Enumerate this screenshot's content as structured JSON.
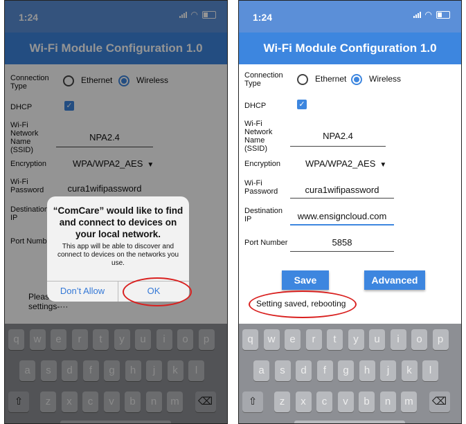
{
  "status": {
    "time": "1:24"
  },
  "app_title": "Wi-Fi Module Configuration 1.0",
  "labels": {
    "connection_type": "Connection Type",
    "dhcp": "DHCP",
    "ssid": "Wi-Fi Network Name (SSID)",
    "encryption": "Encryption",
    "password": "Wi-Fi Password",
    "destination_ip": "Destination IP",
    "port_number": "Port Number",
    "port_number_truncated": "Port Numb"
  },
  "options": {
    "ethernet": "Ethernet",
    "wireless": "Wireless"
  },
  "values": {
    "ssid": "NPA2.4",
    "encryption": "WPA/WPA2_AES",
    "password": "cura1wifipassword",
    "destination_ip": "www.ensigncloud.com",
    "port_number": "5858"
  },
  "dialog": {
    "title": "“ComCare” would like to find and connect to devices on your local network.",
    "body": "This app will be able to discover and connect to devices on the networks you use.",
    "dont_allow": "Don’t Allow",
    "ok": "OK"
  },
  "left_bg_text": {
    "line1": "Pleas",
    "line2": "settings-···"
  },
  "buttons": {
    "save": "Save",
    "advanced": "Advanced"
  },
  "status_message": "Setting saved, rebooting",
  "keyboard": {
    "row1": [
      "q",
      "w",
      "e",
      "r",
      "t",
      "y",
      "u",
      "i",
      "o",
      "p"
    ],
    "row2": [
      "a",
      "s",
      "d",
      "f",
      "g",
      "h",
      "j",
      "k",
      "l"
    ],
    "row3": [
      "z",
      "x",
      "c",
      "v",
      "b",
      "n",
      "m"
    ],
    "shift": "⇧",
    "delete": "⌫"
  },
  "colors": {
    "accent": "#3d86df",
    "status_bar": "#5b8fd8",
    "highlight": "#d9201f"
  }
}
